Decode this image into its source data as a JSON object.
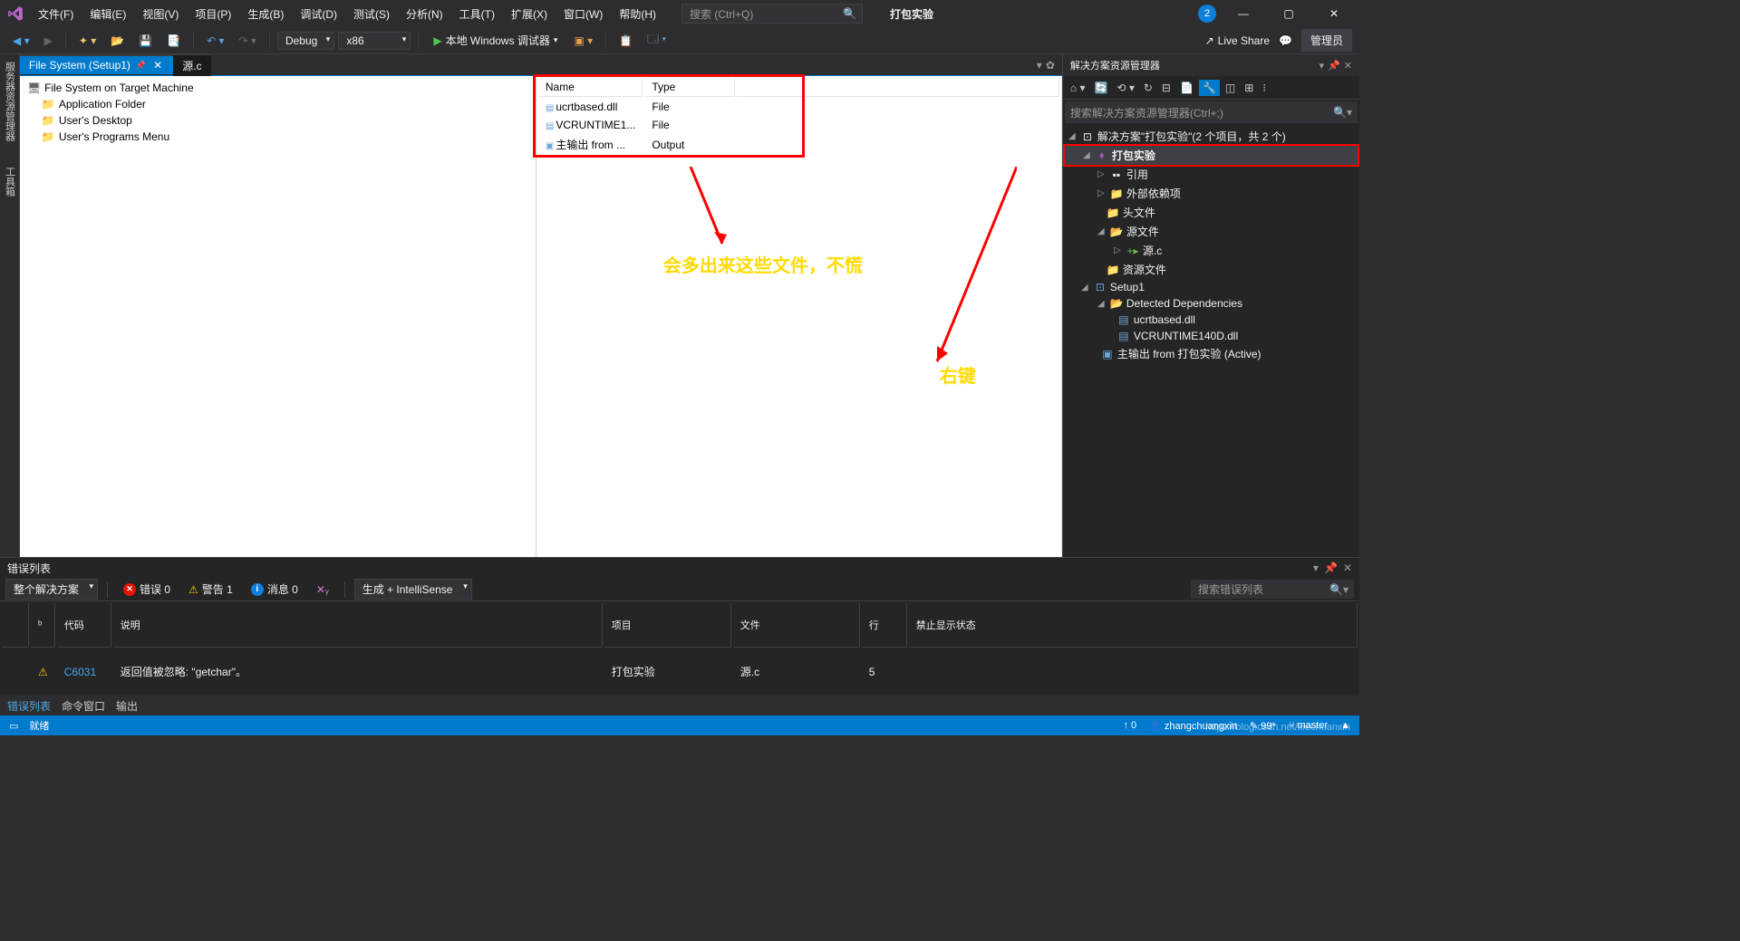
{
  "menubar": {
    "file": "文件(F)",
    "edit": "编辑(E)",
    "view": "视图(V)",
    "project": "项目(P)",
    "build": "生成(B)",
    "debug": "调试(D)",
    "test": "测试(S)",
    "analyze": "分析(N)",
    "tools": "工具(T)",
    "extensions": "扩展(X)",
    "window": "窗口(W)",
    "help": "帮助(H)"
  },
  "search_placeholder": "搜索 (Ctrl+Q)",
  "app_title": "打包实验",
  "notif_count": "2",
  "toolbar": {
    "config": "Debug",
    "platform": "x86",
    "debugger": "本地 Windows 调试器",
    "liveshare": "Live Share",
    "admin": "管理员"
  },
  "left_rail": {
    "server": "服务器资源管理器",
    "toolbox": "工具箱"
  },
  "tabs": {
    "active": "File System (Setup1)",
    "inactive": "源.c"
  },
  "fs_tree": {
    "root": "File System on Target Machine",
    "app_folder": "Application Folder",
    "desktop": "User's Desktop",
    "programs": "User's Programs Menu"
  },
  "file_list": {
    "headers": {
      "name": "Name",
      "type": "Type"
    },
    "rows": [
      {
        "name": "ucrtbased.dll",
        "type": "File"
      },
      {
        "name": "VCRUNTIME1...",
        "type": "File"
      },
      {
        "name": "主输出 from ...",
        "type": "Output"
      }
    ]
  },
  "annotations": {
    "text1": "会多出来这些文件，不慌",
    "text2": "右键"
  },
  "solution": {
    "title": "解决方案资源管理器",
    "search_placeholder": "搜索解决方案资源管理器(Ctrl+;)",
    "root": "解决方案\"打包实验\"(2 个项目，共 2 个)",
    "proj1": "打包实验",
    "refs": "引用",
    "external": "外部依赖项",
    "headers": "头文件",
    "sources": "源文件",
    "source_file": "源.c",
    "resources": "资源文件",
    "proj2": "Setup1",
    "detected": "Detected Dependencies",
    "dep1": "ucrtbased.dll",
    "dep2": "VCRUNTIME140D.dll",
    "output": "主输出 from 打包实验 (Active)"
  },
  "error_list": {
    "title": "错误列表",
    "scope": "整个解决方案",
    "errors": "错误 0",
    "warnings": "警告 1",
    "messages": "消息 0",
    "build_filter": "生成 + IntelliSense",
    "search_placeholder": "搜索错误列表",
    "columns": {
      "code": "代码",
      "desc": "说明",
      "project": "项目",
      "file": "文件",
      "line": "行",
      "suppress": "禁止显示状态"
    },
    "row": {
      "code": "C6031",
      "desc": "返回值被忽略: \"getchar\"。",
      "project": "打包实验",
      "file": "源.c",
      "line": "5"
    },
    "tabs": {
      "errors": "错误列表",
      "cmd": "命令窗口",
      "output": "输出"
    }
  },
  "status": {
    "ready": "就绪",
    "user": "zhangchuangxin",
    "pending": "99*",
    "branch": "master",
    "up": "0"
  },
  "watermark": "https://blog.csdn.net/xiechuanxin"
}
